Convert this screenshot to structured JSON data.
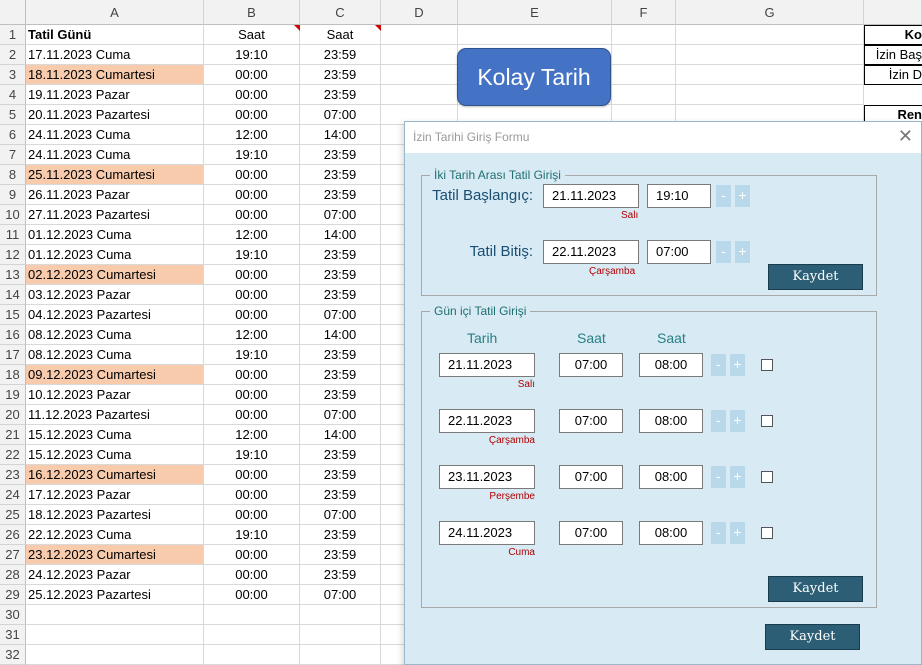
{
  "sheet": {
    "columns": [
      "A",
      "B",
      "C",
      "D",
      "E",
      "F",
      "G"
    ],
    "header_row": [
      "Tatil Günü",
      "Saat",
      "Saat"
    ],
    "rows": [
      [
        "17.11.2023 Cuma",
        "19:10",
        "23:59"
      ],
      [
        "18.11.2023 Cumartesi",
        "00:00",
        "23:59"
      ],
      [
        "19.11.2023 Pazar",
        "00:00",
        "23:59"
      ],
      [
        "20.11.2023 Pazartesi",
        "00:00",
        "07:00"
      ],
      [
        "24.11.2023 Cuma",
        "12:00",
        "14:00"
      ],
      [
        "24.11.2023 Cuma",
        "19:10",
        "23:59"
      ],
      [
        "25.11.2023 Cumartesi",
        "00:00",
        "23:59"
      ],
      [
        "26.11.2023 Pazar",
        "00:00",
        "23:59"
      ],
      [
        "27.11.2023 Pazartesi",
        "00:00",
        "07:00"
      ],
      [
        "01.12.2023 Cuma",
        "12:00",
        "14:00"
      ],
      [
        "01.12.2023 Cuma",
        "19:10",
        "23:59"
      ],
      [
        "02.12.2023 Cumartesi",
        "00:00",
        "23:59"
      ],
      [
        "03.12.2023 Pazar",
        "00:00",
        "23:59"
      ],
      [
        "04.12.2023 Pazartesi",
        "00:00",
        "07:00"
      ],
      [
        "08.12.2023 Cuma",
        "12:00",
        "14:00"
      ],
      [
        "08.12.2023 Cuma",
        "19:10",
        "23:59"
      ],
      [
        "09.12.2023 Cumartesi",
        "00:00",
        "23:59"
      ],
      [
        "10.12.2023 Pazar",
        "00:00",
        "23:59"
      ],
      [
        "11.12.2023 Pazartesi",
        "00:00",
        "07:00"
      ],
      [
        "15.12.2023 Cuma",
        "12:00",
        "14:00"
      ],
      [
        "15.12.2023 Cuma",
        "19:10",
        "23:59"
      ],
      [
        "16.12.2023 Cumartesi",
        "00:00",
        "23:59"
      ],
      [
        "17.12.2023 Pazar",
        "00:00",
        "23:59"
      ],
      [
        "18.12.2023 Pazartesi",
        "00:00",
        "07:00"
      ],
      [
        "22.12.2023 Cuma",
        "19:10",
        "23:59"
      ],
      [
        "23.12.2023 Cumartesi",
        "00:00",
        "23:59"
      ],
      [
        "24.12.2023 Pazar",
        "00:00",
        "23:59"
      ],
      [
        "25.12.2023 Pazartesi",
        "00:00",
        "07:00"
      ]
    ],
    "row_numbers": [
      "1",
      "2",
      "3",
      "4",
      "5",
      "6",
      "7",
      "8",
      "9",
      "10",
      "11",
      "12",
      "13",
      "14",
      "15",
      "16",
      "17",
      "18",
      "19",
      "20",
      "21",
      "22",
      "23",
      "24",
      "25",
      "26",
      "27",
      "28",
      "29",
      "30",
      "31",
      "32"
    ],
    "saturday_highlight_color": "#f8cbad",
    "right_partial": [
      "Ko",
      "İzin Baş",
      "İzin D",
      "Ren"
    ]
  },
  "kolay_button": "Kolay Tarih",
  "dialog": {
    "title": "İzin Tarihi Giriş Formu",
    "close_symbol": "✕",
    "range_frame": {
      "title": "İki Tarih Arası Tatil Girişi",
      "start_label": "Tatil Başlangıç:",
      "start_date": "21.11.2023",
      "start_time": "19:10",
      "start_day": "Salı",
      "end_label": "Tatil Bitiş:",
      "end_date": "22.11.2023",
      "end_time": "07:00",
      "end_day": "Çarşamba",
      "save_label": "Kaydet"
    },
    "day_frame": {
      "title": "Gün içi Tatil Girişi",
      "col_date": "Tarih",
      "col_time1": "Saat",
      "col_time2": "Saat",
      "rows": [
        {
          "date": "21.11.2023",
          "day": "Salı",
          "t1": "07:00",
          "t2": "08:00",
          "checked": false
        },
        {
          "date": "22.11.2023",
          "day": "Çarşamba",
          "t1": "07:00",
          "t2": "08:00",
          "checked": false
        },
        {
          "date": "23.11.2023",
          "day": "Perşembe",
          "t1": "07:00",
          "t2": "08:00",
          "checked": false
        },
        {
          "date": "24.11.2023",
          "day": "Cuma",
          "t1": "07:00",
          "t2": "08:00",
          "checked": false
        }
      ],
      "save_label": "Kaydet"
    },
    "stepper_minus": "-",
    "stepper_plus": "+",
    "bottom_save_label": "Kaydet"
  }
}
